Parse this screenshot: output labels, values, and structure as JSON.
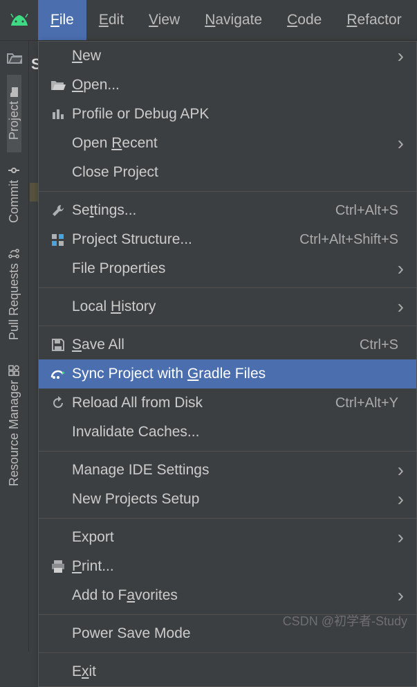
{
  "menubar": {
    "items": [
      {
        "label": "File",
        "mnemonic_index": 0,
        "active": true
      },
      {
        "label": "Edit",
        "mnemonic_index": 0
      },
      {
        "label": "View",
        "mnemonic_index": 0
      },
      {
        "label": "Navigate",
        "mnemonic_index": 0
      },
      {
        "label": "Code",
        "mnemonic_index": 0
      },
      {
        "label": "Refactor",
        "mnemonic_index": 0
      }
    ]
  },
  "sidebar": {
    "truncated_label": "Soc",
    "tabs": [
      {
        "label": "Project",
        "icon": "folder-icon"
      },
      {
        "label": "Commit",
        "icon": "commit-icon"
      },
      {
        "label": "Pull Requests",
        "icon": "pull-request-icon"
      },
      {
        "label": "Resource Manager",
        "icon": "resource-icon"
      }
    ]
  },
  "dropdown": {
    "sections": [
      [
        {
          "label": "New",
          "mnemonic_index": 0,
          "submenu": true
        },
        {
          "label": "Open...",
          "mnemonic_index": 0,
          "icon": "open-folder-icon"
        },
        {
          "label": "Profile or Debug APK",
          "icon": "profile-icon"
        },
        {
          "label": "Open Recent",
          "mnemonic_index": 5,
          "submenu": true
        },
        {
          "label": "Close Project"
        }
      ],
      [
        {
          "label": "Settings...",
          "mnemonic_index": 2,
          "icon": "wrench-icon",
          "shortcut": "Ctrl+Alt+S"
        },
        {
          "label": "Project Structure...",
          "mnemonic_index": -1,
          "icon": "structure-icon",
          "shortcut": "Ctrl+Alt+Shift+S"
        },
        {
          "label": "File Properties",
          "submenu": true
        }
      ],
      [
        {
          "label": "Local History",
          "mnemonic_index": 6,
          "submenu": true
        }
      ],
      [
        {
          "label": "Save All",
          "mnemonic_index": 0,
          "icon": "save-icon",
          "shortcut": "Ctrl+S"
        },
        {
          "label": "Sync Project with Gradle Files",
          "mnemonic_index": 18,
          "icon": "sync-gradle-icon",
          "selected": true
        },
        {
          "label": "Reload All from Disk",
          "icon": "reload-icon",
          "shortcut": "Ctrl+Alt+Y"
        },
        {
          "label": "Invalidate Caches..."
        }
      ],
      [
        {
          "label": "Manage IDE Settings",
          "submenu": true
        },
        {
          "label": "New Projects Setup",
          "submenu": true
        }
      ],
      [
        {
          "label": "Export",
          "submenu": true
        },
        {
          "label": "Print...",
          "mnemonic_index": 0,
          "icon": "print-icon"
        },
        {
          "label": "Add to Favorites",
          "mnemonic_index": 8,
          "submenu": true
        }
      ],
      [
        {
          "label": "Power Save Mode"
        }
      ],
      [
        {
          "label": "Exit",
          "mnemonic_index": 1
        }
      ]
    ]
  },
  "watermark": "CSDN @初学者-Study",
  "icons": {
    "android": "android-logo-icon"
  }
}
